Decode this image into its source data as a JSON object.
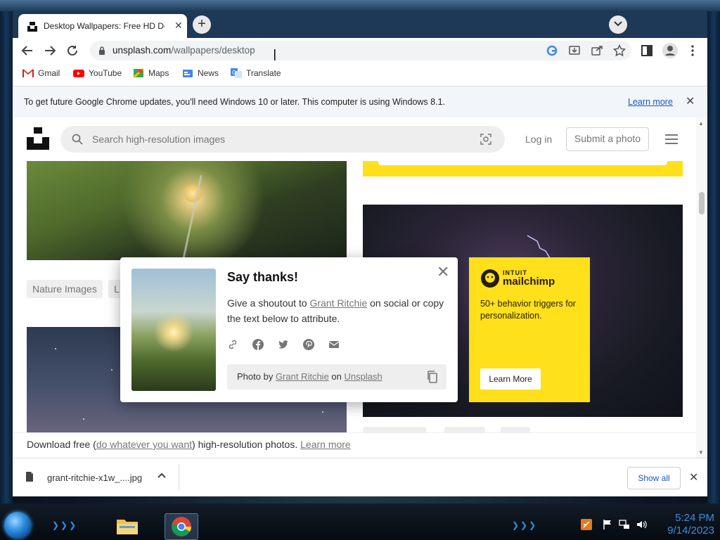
{
  "browser": {
    "tab": {
      "title": "Desktop Wallpapers: Free HD Do",
      "close": "✕"
    },
    "new_tab": "+",
    "address": {
      "host": "unsplash.com",
      "path": "/wallpapers/desktop"
    },
    "bookmarks": [
      {
        "label": "Gmail",
        "icon": "gmail-icon"
      },
      {
        "label": "YouTube",
        "icon": "youtube-icon"
      },
      {
        "label": "Maps",
        "icon": "maps-icon"
      },
      {
        "label": "News",
        "icon": "news-icon"
      },
      {
        "label": "Translate",
        "icon": "translate-icon"
      }
    ],
    "infobar": {
      "message": "To get future Google Chrome updates, you'll need Windows 10 or later. This computer is using Windows 8.1.",
      "learn_more": "Learn more",
      "close": "✕"
    }
  },
  "unsplash": {
    "search_placeholder": "Search high-resolution images",
    "login": "Log in",
    "submit": "Submit a photo",
    "tags_left": [
      "Nature Images",
      "L"
    ],
    "footer": {
      "prefix": "Download free (",
      "link1": "do whatever you want",
      "middle": ") high-resolution photos.",
      "link2": "Learn more"
    }
  },
  "modal": {
    "title": "Say thanks!",
    "body_prefix": "Give a shoutout to ",
    "body_link": "Grant Ritchie",
    "body_suffix": " on social or copy the text below to attribute.",
    "credit_prefix": "Photo by ",
    "credit_author": "Grant Ritchie",
    "credit_mid": " on ",
    "credit_site": "Unsplash",
    "close": "✕",
    "share_icons": [
      "link-icon",
      "facebook-icon",
      "twitter-icon",
      "pinterest-icon",
      "email-icon"
    ]
  },
  "ad": {
    "brand_top": "INTUIT",
    "brand": "mailchimp",
    "copy": "50+ behavior triggers for personalization.",
    "cta": "Learn More",
    "color": "#ffe01b"
  },
  "downloads": {
    "filename": "grant-ritchie-x1w_....jpg",
    "show_all": "Show all",
    "close": "✕"
  },
  "taskbar": {
    "time": "5:24 PM",
    "date": "9/14/2023"
  }
}
